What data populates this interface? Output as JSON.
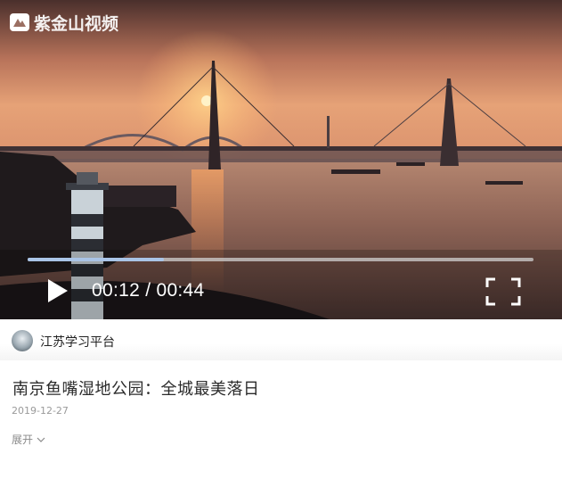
{
  "video": {
    "watermark_text": "紫金山视频",
    "current_time": "00:12",
    "separator": " / ",
    "duration": "00:44",
    "progress_fraction": 0.27,
    "icons": {
      "play": "play-icon",
      "fullscreen": "fullscreen-icon",
      "watermark": "zijinshan-logo-icon"
    }
  },
  "author": {
    "name": "江苏学习平台"
  },
  "article": {
    "title": "南京鱼嘴湿地公园：全城最美落日",
    "date": "2019-12-27",
    "expand_label": "展开"
  },
  "colors": {
    "progress_fill": "#a9c4e6",
    "progress_track": "#d2d2d2"
  }
}
